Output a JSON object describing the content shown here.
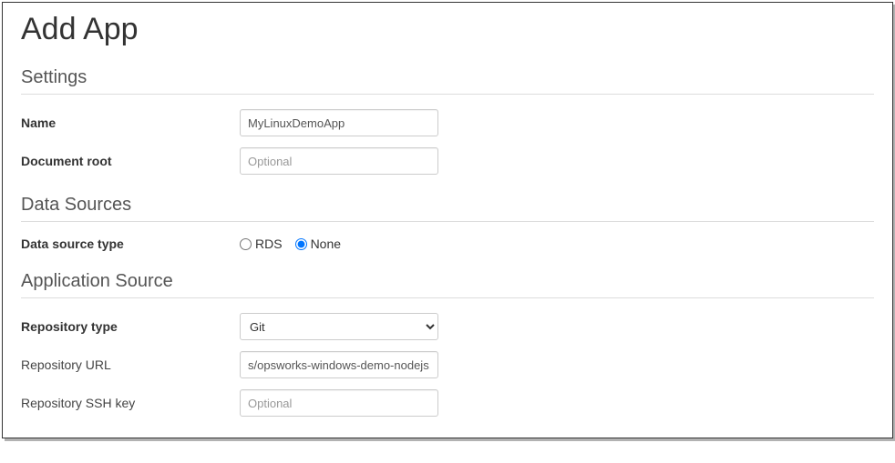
{
  "page": {
    "title": "Add App"
  },
  "settings": {
    "heading": "Settings",
    "name_label": "Name",
    "name_value": "MyLinuxDemoApp",
    "docroot_label": "Document root",
    "docroot_placeholder": "Optional"
  },
  "data_sources": {
    "heading": "Data Sources",
    "type_label": "Data source type",
    "options": {
      "rds": "RDS",
      "none": "None"
    },
    "selected": "none"
  },
  "application_source": {
    "heading": "Application Source",
    "repo_type_label": "Repository type",
    "repo_type_value": "Git",
    "repo_url_label": "Repository URL",
    "repo_url_value": "s/opsworks-windows-demo-nodejs.git",
    "repo_ssh_label": "Repository SSH key",
    "repo_ssh_placeholder": "Optional"
  }
}
